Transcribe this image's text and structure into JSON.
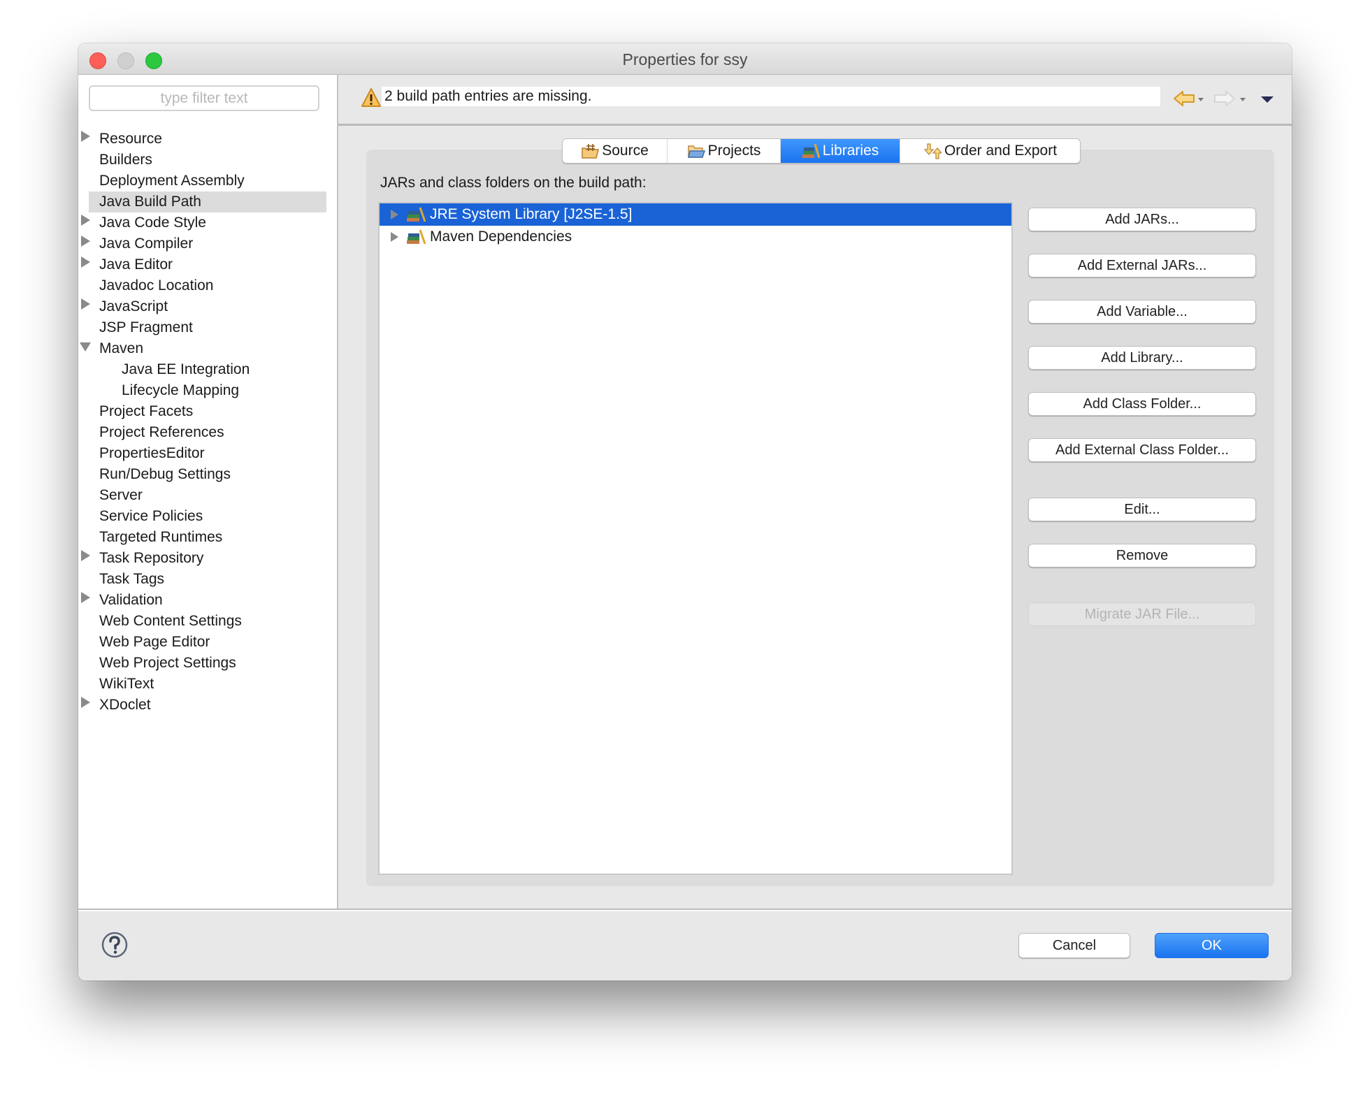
{
  "window": {
    "title": "Properties for ssy"
  },
  "sidebar": {
    "filter_placeholder": "type filter text",
    "items": [
      {
        "label": "Resource",
        "expander": "closed",
        "level": 0
      },
      {
        "label": "Builders",
        "expander": "none",
        "level": 0
      },
      {
        "label": "Deployment Assembly",
        "expander": "none",
        "level": 0
      },
      {
        "label": "Java Build Path",
        "expander": "none",
        "level": 0,
        "selected": true
      },
      {
        "label": "Java Code Style",
        "expander": "closed",
        "level": 0
      },
      {
        "label": "Java Compiler",
        "expander": "closed",
        "level": 0
      },
      {
        "label": "Java Editor",
        "expander": "closed",
        "level": 0
      },
      {
        "label": "Javadoc Location",
        "expander": "none",
        "level": 0
      },
      {
        "label": "JavaScript",
        "expander": "closed",
        "level": 0
      },
      {
        "label": "JSP Fragment",
        "expander": "none",
        "level": 0
      },
      {
        "label": "Maven",
        "expander": "open",
        "level": 0
      },
      {
        "label": "Java EE Integration",
        "expander": "none",
        "level": 1
      },
      {
        "label": "Lifecycle Mapping",
        "expander": "none",
        "level": 1
      },
      {
        "label": "Project Facets",
        "expander": "none",
        "level": 0
      },
      {
        "label": "Project References",
        "expander": "none",
        "level": 0
      },
      {
        "label": "PropertiesEditor",
        "expander": "none",
        "level": 0
      },
      {
        "label": "Run/Debug Settings",
        "expander": "none",
        "level": 0
      },
      {
        "label": "Server",
        "expander": "none",
        "level": 0
      },
      {
        "label": "Service Policies",
        "expander": "none",
        "level": 0
      },
      {
        "label": "Targeted Runtimes",
        "expander": "none",
        "level": 0
      },
      {
        "label": "Task Repository",
        "expander": "closed",
        "level": 0
      },
      {
        "label": "Task Tags",
        "expander": "none",
        "level": 0
      },
      {
        "label": "Validation",
        "expander": "closed",
        "level": 0
      },
      {
        "label": "Web Content Settings",
        "expander": "none",
        "level": 0
      },
      {
        "label": "Web Page Editor",
        "expander": "none",
        "level": 0
      },
      {
        "label": "Web Project Settings",
        "expander": "none",
        "level": 0
      },
      {
        "label": "WikiText",
        "expander": "none",
        "level": 0
      },
      {
        "label": "XDoclet",
        "expander": "closed",
        "level": 0
      }
    ]
  },
  "message": {
    "icon": "warning-icon",
    "text": "2 build path entries are missing."
  },
  "nav": {
    "back_icon": "back-arrow-icon",
    "forward_icon": "forward-arrow-icon",
    "menu_icon": "view-menu-icon"
  },
  "tabs": [
    {
      "label": "Source",
      "icon": "source-folder-icon",
      "active": false
    },
    {
      "label": "Projects",
      "icon": "projects-folder-icon",
      "active": false
    },
    {
      "label": "Libraries",
      "icon": "libraries-icon",
      "active": true
    },
    {
      "label": "Order and Export",
      "icon": "order-export-icon",
      "active": false
    }
  ],
  "libraries": {
    "label": "JARs and class folders on the build path:",
    "entries": [
      {
        "label": "JRE System Library [J2SE-1.5]",
        "selected": true
      },
      {
        "label": "Maven Dependencies",
        "selected": false
      }
    ],
    "buttons": [
      {
        "label": "Add JARs...",
        "enabled": true
      },
      {
        "label": "Add External JARs...",
        "enabled": true
      },
      {
        "label": "Add Variable...",
        "enabled": true
      },
      {
        "label": "Add Library...",
        "enabled": true
      },
      {
        "label": "Add Class Folder...",
        "enabled": true
      },
      {
        "label": "Add External Class Folder...",
        "enabled": true
      },
      {
        "label": "Edit...",
        "enabled": true
      },
      {
        "label": "Remove",
        "enabled": true
      },
      {
        "label": "Migrate JAR File...",
        "enabled": false
      }
    ]
  },
  "footer": {
    "cancel_label": "Cancel",
    "ok_label": "OK"
  },
  "colors": {
    "accent": "#1a73f0",
    "selection": "#1a63d6",
    "sidebar_selection": "#dcdcdc",
    "warning": "#f5a623"
  }
}
